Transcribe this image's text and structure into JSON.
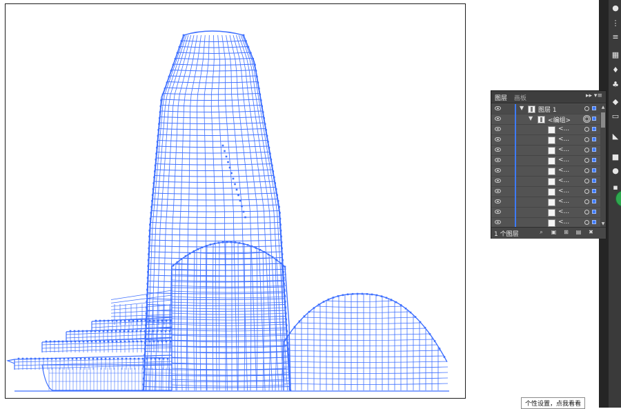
{
  "layers_panel": {
    "tabs": [
      "图层",
      "画板"
    ],
    "menu_glyph": "▸▸ ▾≡",
    "layer_name": "图层 1",
    "group_name": "<编组>",
    "sublayer_label": "<...",
    "sublayer_count": 10,
    "layer_count_label": "1 个图层",
    "accent_color": "#3d7bff"
  },
  "tooltip": {
    "text": "个性设置，点我看看"
  },
  "toolbar": {
    "icons": [
      "globe-icon",
      "transform-icon",
      "align-icon",
      "pathfinder-icon",
      "brush-icon",
      "symbol-icon",
      "layers-icon",
      "artboards-icon",
      "gradient-icon",
      "transparency-icon",
      "appearance-icon",
      "graphic-styles-icon",
      "go-button"
    ]
  },
  "artwork": {
    "wire_color": "#3d6fff",
    "subject": "building-wireframe"
  }
}
